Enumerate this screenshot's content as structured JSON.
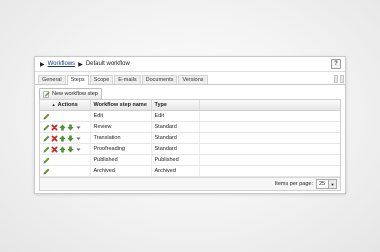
{
  "breadcrumb": {
    "root_label": "Workflows",
    "current_label": "Default workflow"
  },
  "help_label": "?",
  "tabs": [
    {
      "label": "General"
    },
    {
      "label": "Steps"
    },
    {
      "label": "Scope"
    },
    {
      "label": "E-mails"
    },
    {
      "label": "Documents"
    },
    {
      "label": "Versions"
    }
  ],
  "active_tab": "Steps",
  "toolbar": {
    "new_step_label": "New workflow step"
  },
  "grid": {
    "columns": {
      "actions": "Actions",
      "name": "Workflow step name",
      "type": "Type"
    },
    "rows": [
      {
        "name": "Edit",
        "type": "Edit"
      },
      {
        "name": "Review",
        "type": "Standard"
      },
      {
        "name": "Translation",
        "type": "Standard"
      },
      {
        "name": "Proofreading",
        "type": "Standard"
      },
      {
        "name": "Published",
        "type": "Published"
      },
      {
        "name": "Archived",
        "type": "Archived"
      }
    ]
  },
  "pager": {
    "label": "Items per page:",
    "value": "25"
  },
  "colors": {
    "edit_icon": "#5a8a2a",
    "delete_icon": "#d22",
    "arrow_icon": "#4a9a2a",
    "link": "#1a3c7a"
  },
  "icons": {
    "edit": "pencil-icon",
    "delete": "delete-icon",
    "move_up": "arrow-up-icon",
    "move_down": "arrow-down-icon",
    "more": "chevron-down-icon"
  }
}
